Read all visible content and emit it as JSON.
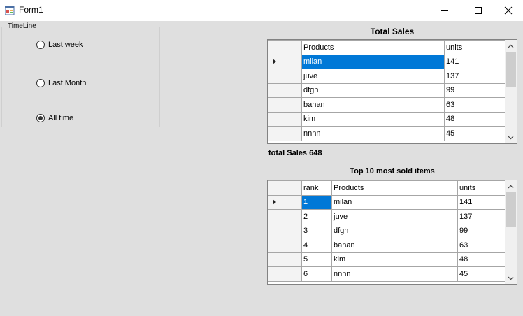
{
  "window": {
    "title": "Form1",
    "minimize_icon": "minimize-icon",
    "maximize_icon": "maximize-icon",
    "close_icon": "close-icon"
  },
  "timeline": {
    "label": "TimeLine",
    "options": [
      {
        "label": "Last week",
        "checked": false
      },
      {
        "label": "Last Month",
        "checked": false
      },
      {
        "label": "All time",
        "checked": true
      }
    ]
  },
  "total_sales": {
    "title": "Total Sales",
    "columns": [
      "Products",
      "units"
    ],
    "rows": [
      [
        "milan",
        "141"
      ],
      [
        "juve",
        "137"
      ],
      [
        "dfgh",
        "99"
      ],
      [
        "banan",
        "63"
      ],
      [
        "kim",
        "48"
      ],
      [
        "nnnn",
        "45"
      ]
    ],
    "summary": "total Sales 648"
  },
  "top10": {
    "title": "Top 10 most sold items",
    "columns": [
      "rank",
      "Products",
      "units"
    ],
    "rows": [
      [
        "1",
        "milan",
        "141"
      ],
      [
        "2",
        "juve",
        "137"
      ],
      [
        "3",
        "dfgh",
        "99"
      ],
      [
        "4",
        "banan",
        "63"
      ],
      [
        "5",
        "kim",
        "48"
      ],
      [
        "6",
        "nnnn",
        "45"
      ]
    ]
  }
}
